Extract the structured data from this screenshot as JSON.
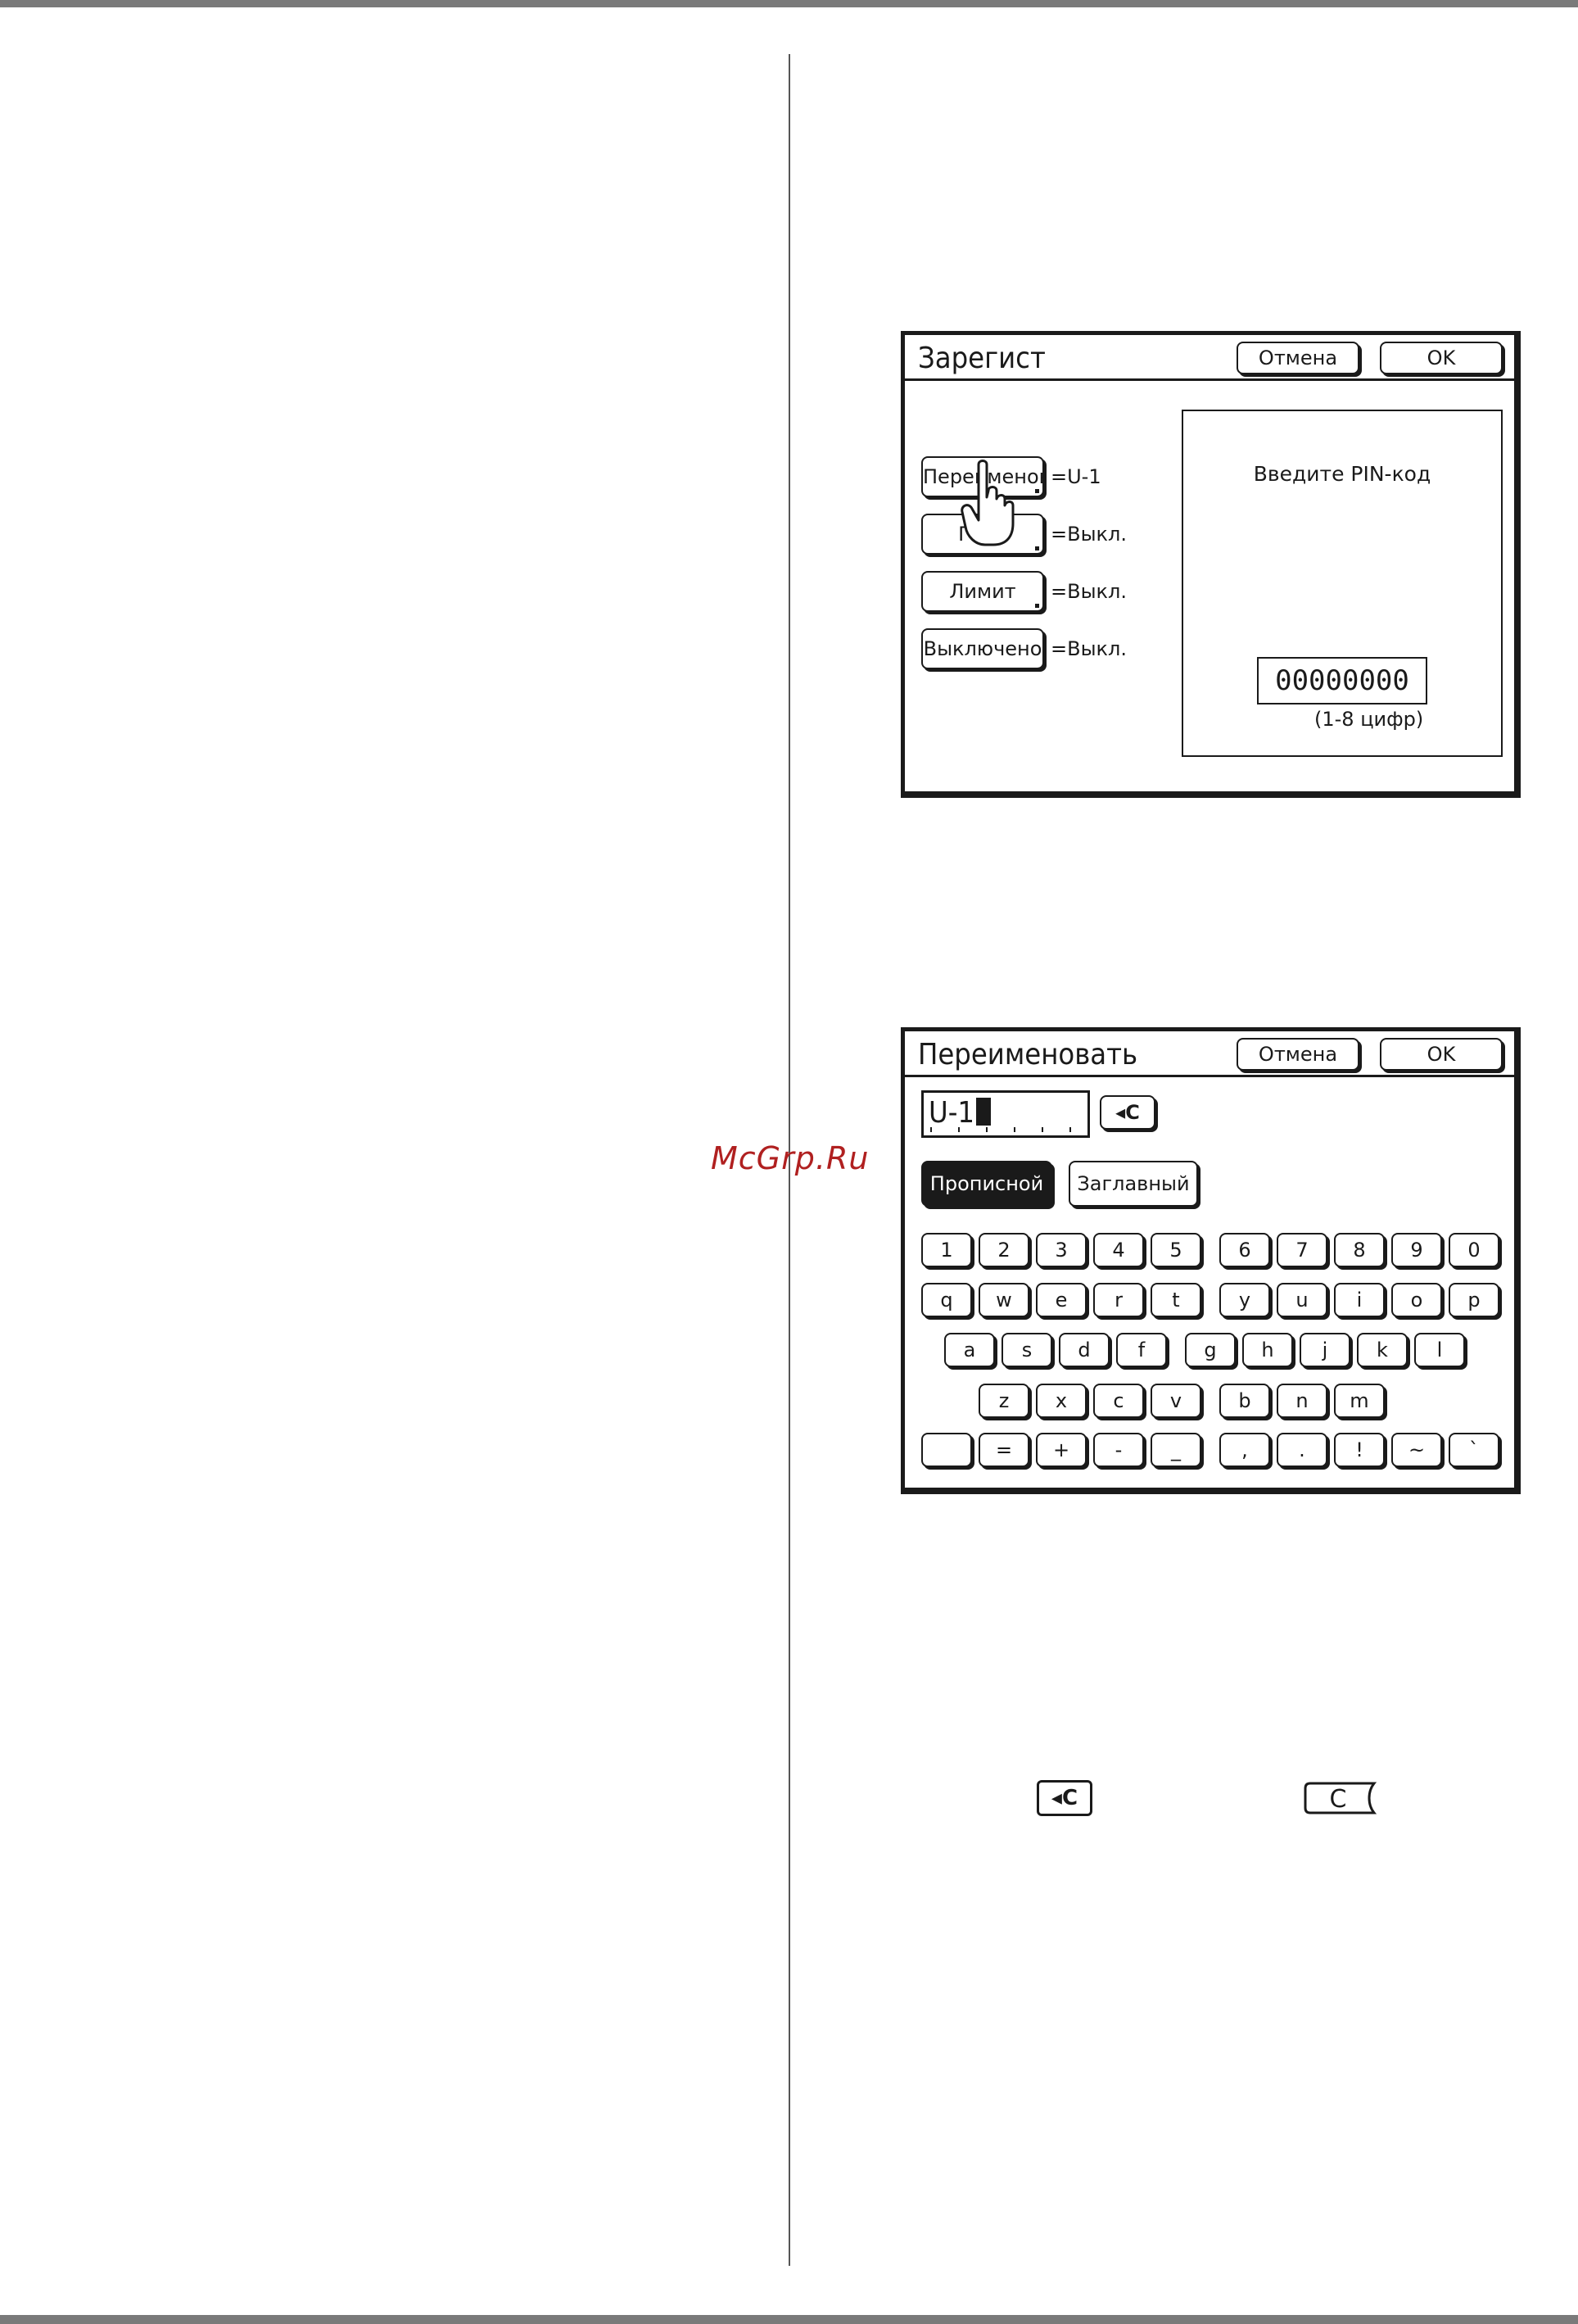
{
  "watermark": "McGrp.Ru",
  "register_screen": {
    "title": "Зарегист",
    "cancel_label": "Отмена",
    "ok_label": "OK",
    "options": [
      {
        "label": "Переименов",
        "value": "=U-1"
      },
      {
        "label": "Г    а",
        "value": "=Выкл."
      },
      {
        "label": "Лимит",
        "value": "=Выкл."
      },
      {
        "label": "Выключено",
        "value": "=Выкл."
      }
    ],
    "pin_prompt": "Введите PIN-код",
    "pin_value": "00000000",
    "pin_hint": "(1-8 цифр)"
  },
  "rename_screen": {
    "title": "Переименовать",
    "cancel_label": "Отмена",
    "ok_label": "OK",
    "name_value": "U-1",
    "backspace_label": "◂C",
    "lowercase_label": "Прописной",
    "uppercase_label": "Заглавный",
    "rows": [
      [
        "1",
        "2",
        "3",
        "4",
        "5",
        "6",
        "7",
        "8",
        "9",
        "0"
      ],
      [
        "q",
        "w",
        "e",
        "r",
        "t",
        "y",
        "u",
        "i",
        "o",
        "p"
      ],
      [
        "a",
        "s",
        "d",
        "f",
        "g",
        "h",
        "j",
        "k",
        "l"
      ],
      [
        "z",
        "x",
        "c",
        "v",
        "b",
        "n",
        "m"
      ],
      [
        "",
        "=",
        "+",
        "-",
        "_",
        ",",
        ".",
        "!",
        "~",
        "`"
      ]
    ]
  },
  "footer_icons": {
    "backspace_label": "◂C",
    "clear_label": "C"
  }
}
